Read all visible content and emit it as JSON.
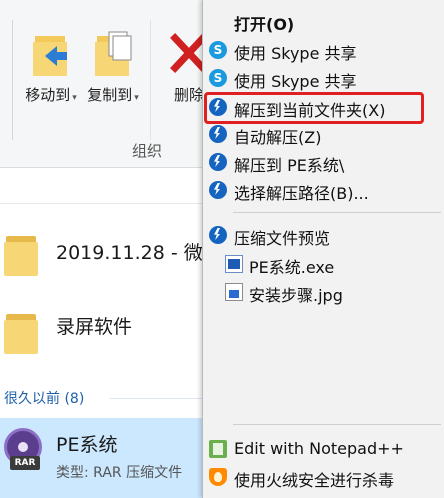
{
  "ribbon": {
    "move_to": "移动到",
    "copy_to": "复制到",
    "delete": "删除",
    "group_label": "组织"
  },
  "files": [
    {
      "name": "2019.11.28 - 微"
    },
    {
      "name": "录屏软件"
    }
  ],
  "section": {
    "label": "很久以前 (8)"
  },
  "selected_file": {
    "name": "PE系统",
    "meta": "类型: RAR 压缩文件",
    "icon_badge": "RAR"
  },
  "context_menu": {
    "items": [
      {
        "label": "打开(O)",
        "icon": ""
      },
      {
        "label": "使用 Skype 共享",
        "icon": "skype-icon"
      },
      {
        "label": "使用 Skype 共享",
        "icon": "skype-icon"
      },
      {
        "label": "解压到当前文件夹(X)",
        "icon": "bandizip-icon"
      },
      {
        "label": "自动解压(Z)",
        "icon": "bandizip-icon"
      },
      {
        "label": "解压到 PE系统\\",
        "icon": "bandizip-icon"
      },
      {
        "label": "选择解压路径(B)...",
        "icon": "bandizip-icon"
      },
      {
        "label": "压缩文件预览",
        "icon": "bandizip-icon"
      },
      {
        "label": "PE系统.exe",
        "icon": "exe-file-icon"
      },
      {
        "label": "安装步骤.jpg",
        "icon": "jpg-file-icon"
      },
      {
        "label": "Edit with Notepad++",
        "icon": "notepad-plus-plus-icon"
      },
      {
        "label": "使用火绒安全进行杀毒",
        "icon": "huorong-icon"
      }
    ],
    "skype_glyph": "S",
    "highlight_color": "#e02020"
  }
}
